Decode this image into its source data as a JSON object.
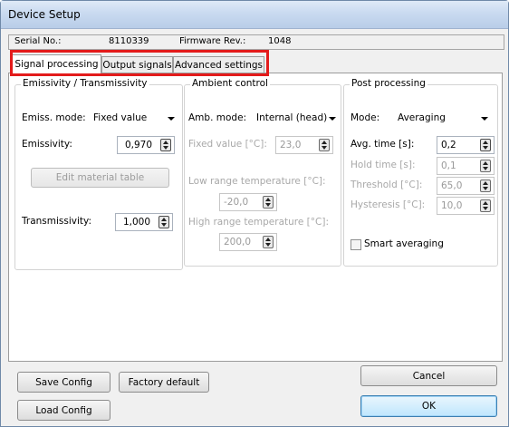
{
  "window": {
    "title": "Device Setup"
  },
  "device": {
    "serial_label": "Serial No.:",
    "serial_value": "8110339",
    "firmware_label": "Firmware Rev.:",
    "firmware_value": "1048"
  },
  "tabs": [
    {
      "label": "Signal processing",
      "active": true
    },
    {
      "label": "Output signals",
      "active": false
    },
    {
      "label": "Advanced settings",
      "active": false
    }
  ],
  "emissivity": {
    "group_title": "Emissivity / Transmissivity",
    "mode_label": "Emiss. mode:",
    "mode_value": "Fixed value",
    "emissivity_label": "Emissivity:",
    "emissivity_value": "0,970",
    "edit_table_button": "Edit material table",
    "transmissivity_label": "Transmissivity:",
    "transmissivity_value": "1,000"
  },
  "ambient": {
    "group_title": "Ambient control",
    "mode_label": "Amb. mode:",
    "mode_value": "Internal (head)",
    "fixed_label": "Fixed value [°C]:",
    "fixed_value": "23,0",
    "low_label": "Low range temperature [°C]:",
    "low_value": "-20,0",
    "high_label": "High range temperature [°C]:",
    "high_value": "200,0"
  },
  "post": {
    "group_title": "Post processing",
    "mode_label": "Mode:",
    "mode_value": "Averaging",
    "avg_label": "Avg. time [s]:",
    "avg_value": "0,2",
    "hold_label": "Hold time [s]:",
    "hold_value": "0,1",
    "threshold_label": "Threshold [°C]:",
    "threshold_value": "65,0",
    "hysteresis_label": "Hysteresis [°C]:",
    "hysteresis_value": "10,0",
    "smart_label": "Smart averaging",
    "smart_checked": false
  },
  "buttons": {
    "save_config": "Save Config",
    "factory_default": "Factory default",
    "load_config": "Load Config",
    "cancel": "Cancel",
    "ok": "OK"
  },
  "colors": {
    "highlight": "#e31b1b",
    "disabled_text": "#a8a8a8"
  }
}
